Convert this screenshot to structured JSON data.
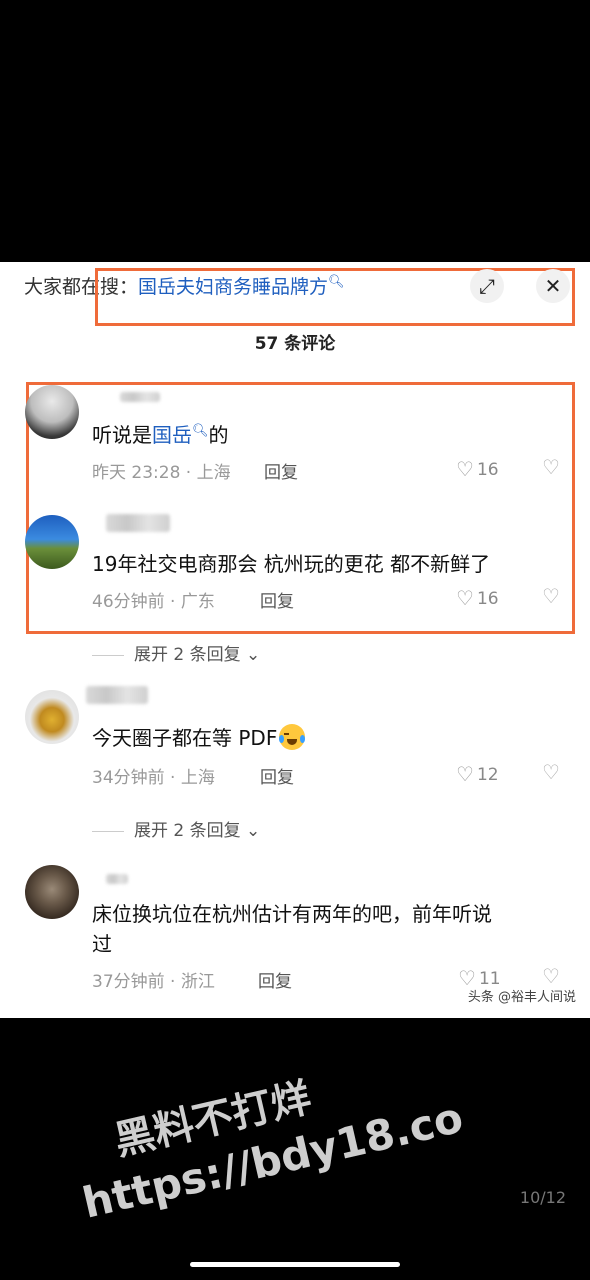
{
  "search": {
    "prefix": "大家都在搜：",
    "term": "国岳夫妇商务睡品牌方",
    "expand_icon": "expand-icon",
    "close_icon": "close-icon"
  },
  "header": {
    "count_label": "57 条评论"
  },
  "comments": [
    {
      "text_before": "听说是",
      "text_link": "国岳",
      "text_after": "的",
      "time": "昨天 23:28 · 上海",
      "reply": "回复",
      "likes": "16"
    },
    {
      "text": "19年社交电商那会 杭州玩的更花 都不新鲜了",
      "time": "46分钟前 · 广东",
      "reply": "回复",
      "likes": "16",
      "expand": "展开 2 条回复"
    },
    {
      "text": "今天圈子都在等 PDF",
      "time": "34分钟前 · 上海",
      "reply": "回复",
      "likes": "12",
      "expand": "展开 2 条回复"
    },
    {
      "text_line1": "床位换坑位在杭州估计有两年的吧，前年听说",
      "text_line2": "过",
      "time": "37分钟前 · 浙江",
      "reply": "回复",
      "likes": "11"
    }
  ],
  "watermarks": {
    "source": "头条 @裕丰人间说",
    "overlay_line1": "黑料不打烊",
    "overlay_line2": "https://bdy18.co"
  },
  "pagination": {
    "label": "10/12"
  },
  "colors": {
    "highlight_box": "#ef6b3a",
    "link": "#1f5fbf"
  }
}
